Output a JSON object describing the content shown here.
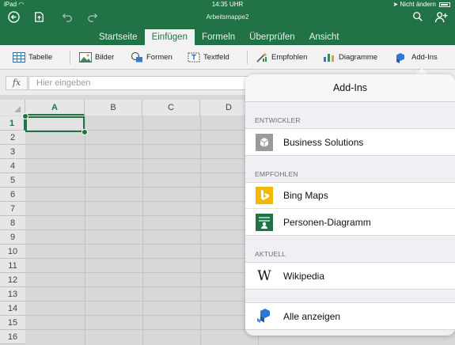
{
  "status": {
    "device": "iPad",
    "time": "14:35 UHR",
    "charge": "Nicht ändern"
  },
  "document_title": "Arbeitsmappe2",
  "tabs": [
    "Startseite",
    "Einfügen",
    "Formeln",
    "Überprüfen",
    "Ansicht"
  ],
  "active_tab": "Einfügen",
  "ribbon": {
    "table": "Tabelle",
    "pictures": "Bilder",
    "shapes": "Formen",
    "textbox": "Textfeld",
    "recommended": "Empfohlen",
    "charts": "Diagramme",
    "addins": "Add-Ins"
  },
  "formula_bar": {
    "fx": "fx",
    "placeholder": "Hier eingeben"
  },
  "grid": {
    "columns": [
      "A",
      "B",
      "C",
      "D"
    ],
    "rows": [
      "1",
      "2",
      "3",
      "4",
      "5",
      "6",
      "7",
      "8",
      "9",
      "10",
      "11",
      "12",
      "13",
      "14",
      "15",
      "16"
    ],
    "selected_cell": "A1"
  },
  "popover": {
    "title": "Add-Ins",
    "sections": [
      {
        "header": "ENTWICKLER",
        "items": [
          {
            "label": "Business Solutions",
            "icon": "business-solutions-icon"
          }
        ]
      },
      {
        "header": "EMPFOHLEN",
        "items": [
          {
            "label": "Bing Maps",
            "icon": "bing-icon"
          },
          {
            "label": "Personen-Diagramm",
            "icon": "people-graph-icon"
          }
        ]
      },
      {
        "header": "AKTUELL",
        "items": [
          {
            "label": "Wikipedia",
            "icon": "wikipedia-icon"
          }
        ]
      }
    ],
    "show_all": "Alle anzeigen"
  },
  "colors": {
    "excel_green": "#217346",
    "bing_yellow": "#f5b800",
    "addin_blue": "#2b78d4"
  }
}
